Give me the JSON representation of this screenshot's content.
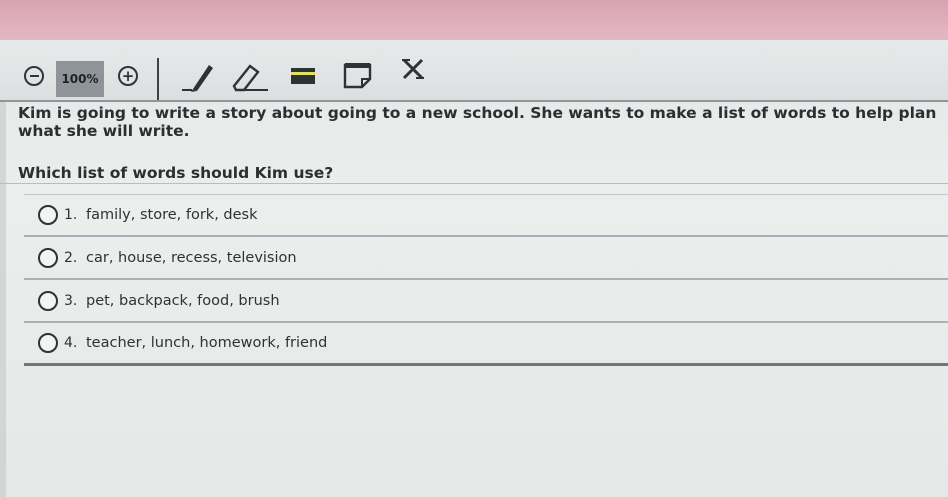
{
  "toolbar": {
    "zoom_level": "100%",
    "zoom_in_symbol": "+",
    "tools": [
      "minus-circle-icon",
      "plus-circle-icon",
      "pencil-icon",
      "eraser-icon",
      "highlighter-icon",
      "notepad-icon",
      "answer-eliminator-icon"
    ]
  },
  "question": {
    "stem": "Kim is going to write a story about going to a new school. She wants to make a list of words to help plan what she will write.",
    "prompt": "Which list of words should Kim use?"
  },
  "choices": [
    {
      "number": "1.",
      "text": "family, store, fork, desk"
    },
    {
      "number": "2.",
      "text": "car, house, recess, television"
    },
    {
      "number": "3.",
      "text": "pet, backpack, food, brush"
    },
    {
      "number": "4.",
      "text": "teacher, lunch, homework, friend"
    }
  ],
  "colors": {
    "header_band": "#e3b3bf",
    "toolbar": "#dcdfe0",
    "zoom_box": "#8e9498",
    "text": "#2b2f31"
  }
}
